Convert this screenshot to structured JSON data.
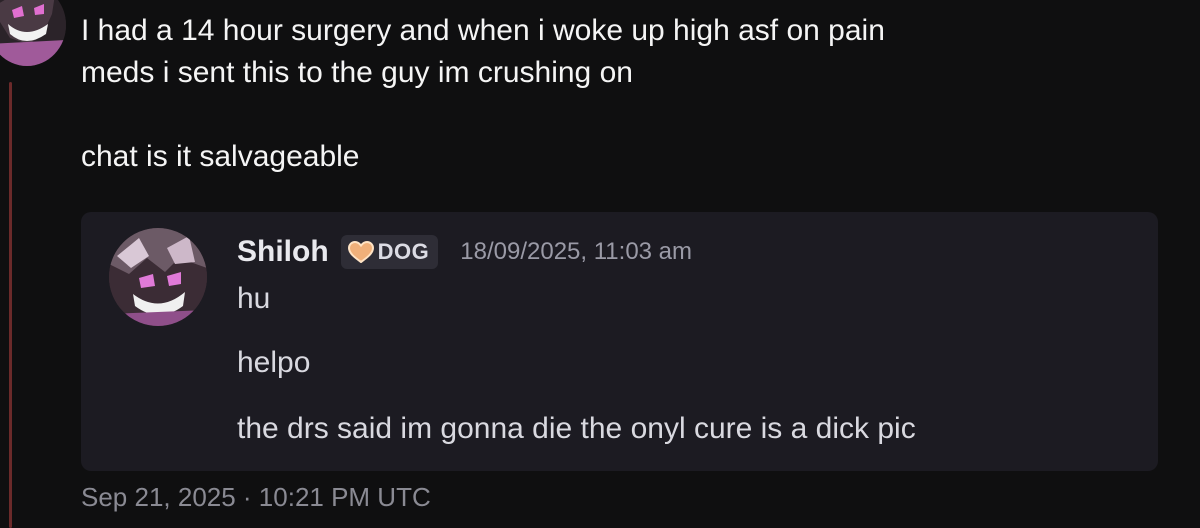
{
  "post": {
    "text": "I had a 14 hour surgery and when i woke up high asf on pain\nmeds i sent this to the guy im crushing on\n\nchat is it salvageable",
    "timestamp": "Sep 21, 2025 · 10:21 PM UTC"
  },
  "embed": {
    "username": "Shiloh",
    "tag_label": "DOG",
    "tag_icon": "heart-icon",
    "timestamp": "18/09/2025, 11:03 am",
    "messages": [
      "hu",
      "helpo",
      "the drs said im gonna die the onyl cure is a dick pic"
    ]
  },
  "colors": {
    "background": "#0f0f10",
    "embed_background": "#1c1b22",
    "thread_line": "#6b2a2a",
    "tag_heart": "#f0b07a"
  }
}
